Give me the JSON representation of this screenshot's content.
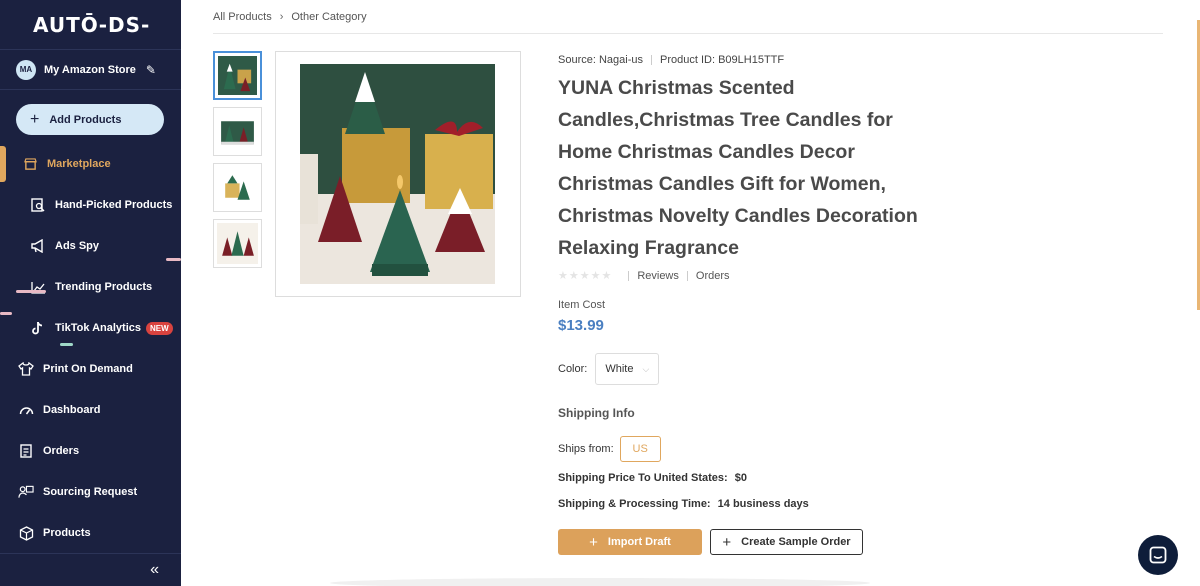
{
  "app": {
    "logo": "AUTŌ-DS-"
  },
  "store": {
    "initials": "MA",
    "name": "My Amazon Store",
    "edit_icon": "pencil-icon"
  },
  "sidebar": {
    "add_button": "Add Products",
    "items": [
      {
        "label": "Marketplace",
        "icon": "store-icon",
        "active": true
      },
      {
        "label": "Hand-Picked Products",
        "icon": "search-doc-icon"
      },
      {
        "label": "Ads Spy",
        "icon": "megaphone-icon"
      },
      {
        "label": "Trending Products",
        "icon": "trend-icon"
      },
      {
        "label": "TikTok Analytics",
        "icon": "tiktok-icon",
        "badge": "NEW"
      },
      {
        "label": "Print On Demand",
        "icon": "shirt-icon"
      },
      {
        "label": "Dashboard",
        "icon": "gauge-icon"
      },
      {
        "label": "Orders",
        "icon": "clipboard-icon"
      },
      {
        "label": "Sourcing Request",
        "icon": "sourcing-icon"
      },
      {
        "label": "Products",
        "icon": "box-icon"
      }
    ],
    "collapse_label": "«"
  },
  "breadcrumb": {
    "root": "All Products",
    "current": "Other Category"
  },
  "product": {
    "source": "Source: Nagai-us",
    "product_id": "Product ID: B09LH15TTF",
    "title": "YUNA Christmas Scented Candles,Christmas Tree Candles for Home Christmas Candles Decor Christmas Candles Gift for Women, Christmas Novelty Candles Decoration Relaxing Fragrance",
    "rating_stars": "★★★★★",
    "reviews_label": "Reviews",
    "orders_label": "Orders",
    "cost_label": "Item Cost",
    "price": "$13.99",
    "color_label": "Color:",
    "color_value": "White"
  },
  "shipping": {
    "title": "Shipping Info",
    "ships_from_label": "Ships from:",
    "ships_from_value": "US",
    "price_label": "Shipping Price To United States:",
    "price_value": "$0",
    "time_label": "Shipping & Processing Time:",
    "time_value": "14 business days"
  },
  "actions": {
    "import_label": "Import Draft",
    "sample_label": "Create Sample Order"
  },
  "colors": {
    "sidebar": "#1b2140",
    "accent": "#e0a75e",
    "price": "#4a7fc1"
  }
}
